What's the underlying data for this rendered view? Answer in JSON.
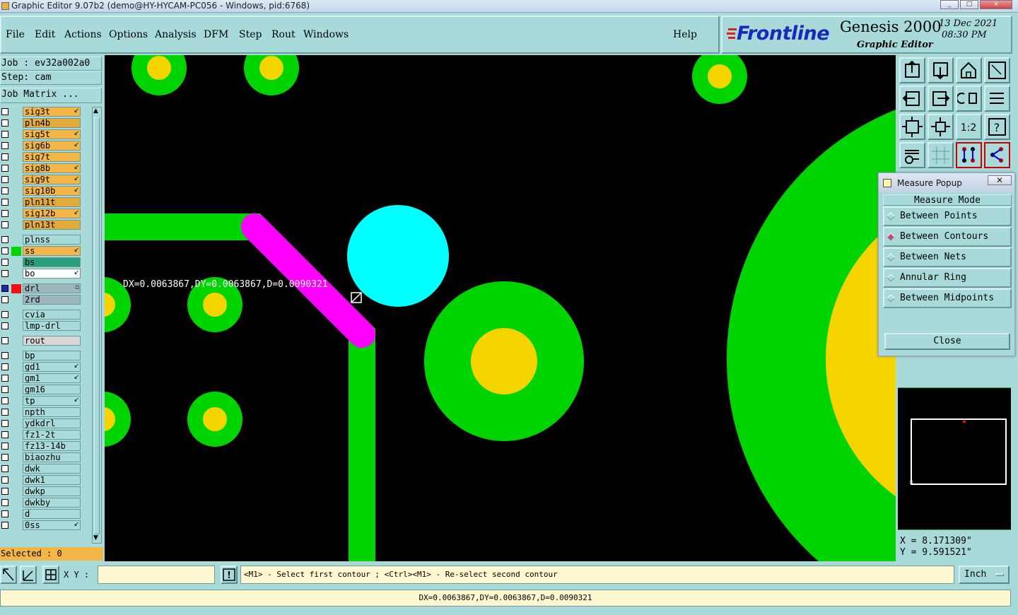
{
  "window": {
    "title": "Graphic Editor 9.07b2 (demo@HY-HYCAM-PC056 - Windows, pid:6768)",
    "minimize": "_",
    "maximize": "□",
    "close": "x"
  },
  "menu": {
    "items": [
      "File",
      "Edit",
      "Actions",
      "Options",
      "Analysis",
      "DFM",
      "Step",
      "Rout",
      "Windows"
    ],
    "help": "Help"
  },
  "brand": {
    "logo": "Frontline",
    "product": "Genesis 2000",
    "subtitle": "Graphic Editor",
    "date": "13 Dec 2021",
    "time": "08:30 PM"
  },
  "left": {
    "job": "Job : ev32a002a0",
    "step": "Step: cam",
    "job_matrix": "Job Matrix ...",
    "selected": "Selected : 0"
  },
  "layers": [
    {
      "name": "sig3t",
      "color": "#f5b648",
      "flag": "↙"
    },
    {
      "name": "pln4b",
      "color": "#e5a83a",
      "flag": ""
    },
    {
      "name": "sig5t",
      "color": "#f5b648",
      "flag": "↙"
    },
    {
      "name": "sig6b",
      "color": "#f5b648",
      "flag": "↙"
    },
    {
      "name": "sig7t",
      "color": "#f5b648",
      "flag": ""
    },
    {
      "name": "sig8b",
      "color": "#f5b648",
      "flag": "↙"
    },
    {
      "name": "sig9t",
      "color": "#f5b648",
      "flag": "↙"
    },
    {
      "name": "sig10b",
      "color": "#f5b648",
      "flag": "↙"
    },
    {
      "name": "pln11t",
      "color": "#e5a83a",
      "flag": ""
    },
    {
      "name": "sig12b",
      "color": "#f5b648",
      "flag": "↙"
    },
    {
      "name": "pln13t",
      "color": "#e5a83a",
      "flag": ""
    },
    {
      "name": "plnss",
      "color": "#a8dada",
      "flag": ""
    },
    {
      "name": "ss",
      "color": "#f5b648",
      "flag": "↙"
    },
    {
      "name": "bs",
      "color": "#2aa07a",
      "flag": ""
    },
    {
      "name": "bo",
      "color": "#ffffff",
      "flag": "↙"
    },
    {
      "name": "drl",
      "color": "#9fb6bc",
      "flag": "▫"
    },
    {
      "name": "2rd",
      "color": "#9fb6bc",
      "flag": ""
    },
    {
      "name": "cvia",
      "color": "#a8dada",
      "flag": ""
    },
    {
      "name": "lmp-drl",
      "color": "#a8dada",
      "flag": ""
    },
    {
      "name": "rout",
      "color": "#d8d8d8",
      "flag": ""
    },
    {
      "name": "bp",
      "color": "#a8dada",
      "flag": ""
    },
    {
      "name": "gd1",
      "color": "#a8dada",
      "flag": "↙"
    },
    {
      "name": "gm1",
      "color": "#a8dada",
      "flag": "↙"
    },
    {
      "name": "gm16",
      "color": "#a8dada",
      "flag": ""
    },
    {
      "name": "tp",
      "color": "#a8dada",
      "flag": "↙"
    },
    {
      "name": "npth",
      "color": "#a8dada",
      "flag": ""
    },
    {
      "name": "ydkdrl",
      "color": "#a8dada",
      "flag": ""
    },
    {
      "name": "fz1-2t",
      "color": "#a8dada",
      "flag": ""
    },
    {
      "name": "fz13-14b",
      "color": "#a8dada",
      "flag": ""
    },
    {
      "name": "biaozhu",
      "color": "#a8dada",
      "flag": ""
    },
    {
      "name": "dwk",
      "color": "#a8dada",
      "flag": ""
    },
    {
      "name": "dwk1",
      "color": "#a8dada",
      "flag": ""
    },
    {
      "name": "dwkp",
      "color": "#a8dada",
      "flag": ""
    },
    {
      "name": "dwkby",
      "color": "#a8dada",
      "flag": ""
    },
    {
      "name": "d",
      "color": "#a8dada",
      "flag": ""
    },
    {
      "name": "0ss",
      "color": "#a8dada",
      "flag": "↙"
    }
  ],
  "canvas": {
    "measure_text": "DX=0.0063867,DY=0.0063867,D=0.0090321",
    "colors": {
      "bg": "#000000",
      "copper": "#00d400",
      "pad": "#f5d400",
      "highlight": "#ff00ff",
      "selected": "#00ffff"
    }
  },
  "measure_popup": {
    "title": "Measure Popup",
    "mode_label": "Measure Mode",
    "options": [
      "Between Points",
      "Between Contours",
      "Between Nets",
      "Annular Ring",
      "Between Midpoints"
    ],
    "selected": "Between Contours",
    "close": "Close"
  },
  "coords": {
    "x": "X = 8.171309\"",
    "y": "Y = 9.591521\""
  },
  "bottom": {
    "xy_label": "X Y :",
    "xy_value": "",
    "prompt": "<M1> - Select first contour ; <Ctrl><M1> - Re-select second contour",
    "unit": "Inch",
    "status": "DX=0.0063867,DY=0.0063867,D=0.0090321",
    "alert": "!"
  }
}
